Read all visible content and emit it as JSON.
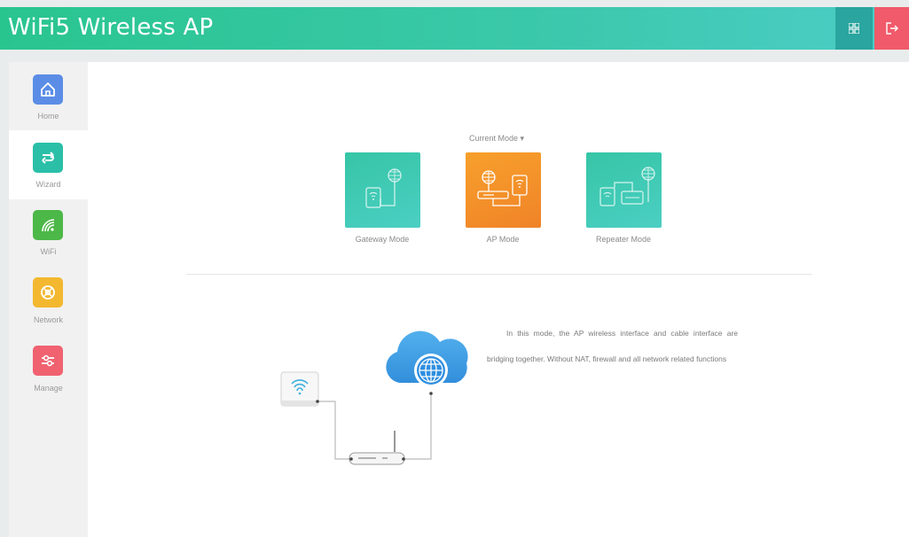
{
  "app": {
    "title": "WiFi5 Wireless AP"
  },
  "header": {
    "grid_icon": "grid-icon",
    "logout_icon": "logout-icon"
  },
  "sidebar": {
    "items": [
      {
        "label": "Home",
        "icon": "home-icon",
        "color": "#5b8de6",
        "active": false
      },
      {
        "label": "Wizard",
        "icon": "wizard-icon",
        "color": "#2bbfa8",
        "active": true
      },
      {
        "label": "WiFi",
        "icon": "wifi-icon",
        "color": "#4cb848",
        "active": false
      },
      {
        "label": "Network",
        "icon": "network-icon",
        "color": "#f3b830",
        "active": false
      },
      {
        "label": "Manage",
        "icon": "manage-icon",
        "color": "#f06270",
        "active": false
      }
    ]
  },
  "modes": {
    "current_label": "Current Mode ▾",
    "items": [
      {
        "label": "Gateway Mode",
        "selected": false
      },
      {
        "label": "AP Mode",
        "selected": true
      },
      {
        "label": "Repeater Mode",
        "selected": false
      }
    ]
  },
  "description": "In this mode, the AP wireless interface and cable interface are bridging together. Without NAT, firewall and all network related functions",
  "colors": {
    "accent": "#3bc8ab",
    "selected_mode": "#f5902a",
    "mode_card": "#3ac9ad",
    "logout": "#f05a6a"
  }
}
